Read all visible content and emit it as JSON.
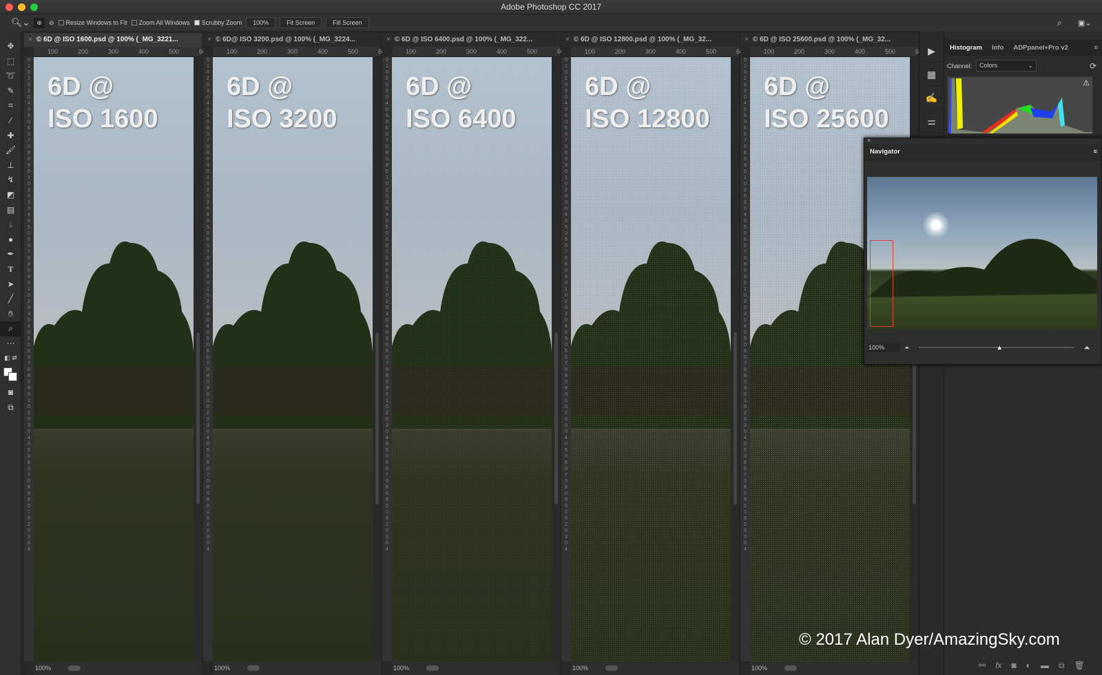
{
  "app": {
    "title": "Adobe Photoshop CC 2017"
  },
  "options": {
    "resize_windows": "Resize Windows to Fit",
    "resize_checked": false,
    "zoom_all": "Zoom All Windows",
    "zoom_all_checked": false,
    "scrubby": "Scrubby Zoom",
    "scrubby_checked": true,
    "zoom_value": "100%",
    "fit_screen": "Fit Screen",
    "fill_screen": "Fill Screen"
  },
  "ruler": [
    "100",
    "200",
    "300",
    "400",
    "500",
    "60"
  ],
  "documents": [
    {
      "tab": "© 6D @ ISO 1600.psd @ 100% (_MG_3221...",
      "line1": "6D @",
      "line2": "ISO 1600",
      "zoom": "100%",
      "active": true
    },
    {
      "tab": "© 6D@ ISO 3200.psd @ 100% (_MG_3224...",
      "line1": "6D @",
      "line2": "ISO 3200",
      "zoom": "100%",
      "active": false
    },
    {
      "tab": "© 6D @ ISO 6400.psd @ 100% (_MG_322...",
      "line1": "6D @",
      "line2": "ISO 6400",
      "zoom": "100%",
      "active": false
    },
    {
      "tab": "© 6D @ ISO 12800.psd @ 100% (_MG_32...",
      "line1": "6D @",
      "line2": "ISO 12800",
      "zoom": "100%",
      "active": false
    },
    {
      "tab": "© 6D @ ISO 25600.psd @ 100% (_MG_32...",
      "line1": "6D @",
      "line2": "ISO 25600",
      "zoom": "100%",
      "active": false
    }
  ],
  "panels": {
    "tabs": [
      "Histogram",
      "Info",
      "ADPpanel+Pro v2"
    ],
    "channel_label": "Channel:",
    "channel_value": "Colors"
  },
  "navigator": {
    "title": "Navigator",
    "zoom": "100%",
    "slider_fraction": 0.5
  },
  "watermark": "© 2017 Alan Dyer/AmazingSky.com",
  "colors": {
    "accent_red": "#e0403a",
    "panel_bg": "#2c2c2c"
  }
}
